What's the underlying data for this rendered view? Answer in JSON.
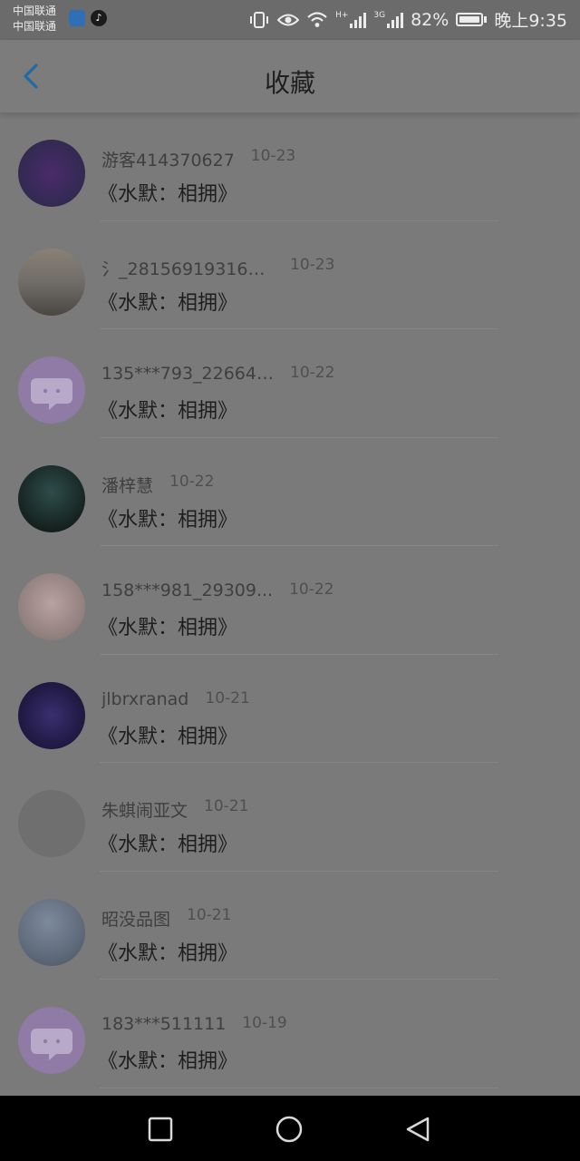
{
  "status_bar": {
    "carrier_1": "中国联通",
    "carrier_2": "中国联通",
    "battery_level": "82%",
    "battery_fraction": 0.82,
    "time": "晚上9:35",
    "network_h": "H+",
    "network_3g": "3G",
    "icons": [
      "vibrate-icon",
      "eye-icon",
      "wifi-icon",
      "signal-icon",
      "battery-icon"
    ]
  },
  "header": {
    "title": "收藏",
    "back_icon": "chevron-left-icon",
    "accent_color": "#1f6aa8"
  },
  "favorites": [
    {
      "username": "游客414370627",
      "date": "10-23",
      "title": "《水默：相拥》"
    },
    {
      "username": "氵_281569193169...",
      "date": "10-23",
      "title": "《水默：相拥》"
    },
    {
      "username": "135***793_226641...",
      "date": "10-22",
      "title": "《水默：相拥》"
    },
    {
      "username": "潘梓慧",
      "date": "10-22",
      "title": "《水默：相拥》"
    },
    {
      "username": "158***981_29309...",
      "date": "10-22",
      "title": "《水默：相拥》"
    },
    {
      "username": "jlbrxranad",
      "date": "10-21",
      "title": "《水默：相拥》"
    },
    {
      "username": "朱蜞闹亚文",
      "date": "10-21",
      "title": "《水默：相拥》"
    },
    {
      "username": "昭没品图",
      "date": "10-21",
      "title": "《水默：相拥》"
    },
    {
      "username": "183***511111",
      "date": "10-19",
      "title": "《水默：相拥》"
    }
  ],
  "nav_bar": {
    "icons": [
      "recent-apps-icon",
      "home-icon",
      "back-triangle-icon"
    ]
  }
}
